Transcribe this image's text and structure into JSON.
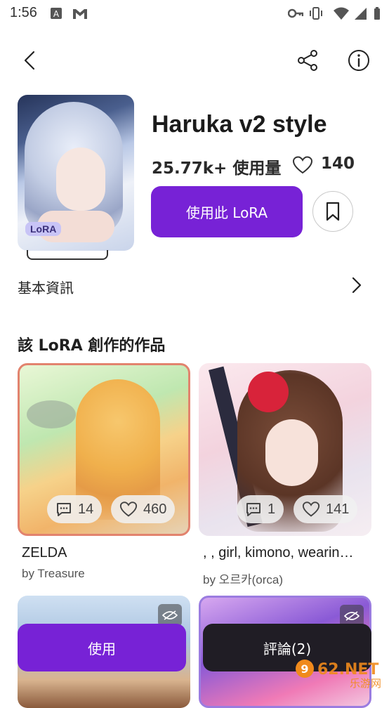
{
  "status_bar": {
    "time": "1:56",
    "icons": [
      "a-badge-icon",
      "gmail-icon",
      "key-icon",
      "vibrate-icon",
      "wifi-icon",
      "signal-icon",
      "battery-icon"
    ]
  },
  "toolbar": {
    "icons": [
      "back-icon",
      "share-icon",
      "info-icon"
    ]
  },
  "model": {
    "title": "Haruka v2 style",
    "usage": "25.77k+ 使用量",
    "likes": "140",
    "badge": "LoRA",
    "use_button": "使用此 LoRA"
  },
  "basic_info": {
    "label": "基本資訊"
  },
  "works": {
    "section_title": "該 LoRA 創作的作品",
    "items": [
      {
        "title": "ZELDA",
        "author": "by Treasure",
        "comments": "14",
        "likes": "460"
      },
      {
        "title": ", , girl, kimono, wearin…",
        "author": "by 오르카(orca)",
        "comments": "1",
        "likes": "141"
      }
    ]
  },
  "bottom_bar": {
    "use_label": "使用",
    "comment_label": "評論(2)"
  },
  "watermark": {
    "text": "962.NET",
    "subtext": "乐游网"
  },
  "colors": {
    "accent": "#7722d6",
    "dark_button": "#201d25",
    "badge_bg": "#c8c4f6"
  }
}
